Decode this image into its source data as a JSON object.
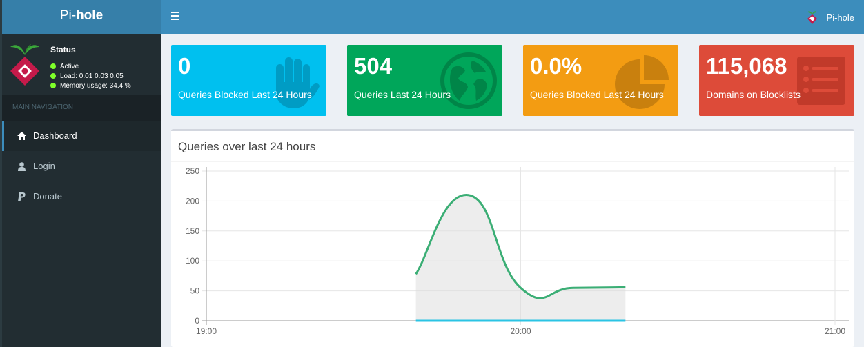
{
  "brand": {
    "prefix": "Pi-",
    "suffix": "hole"
  },
  "topbar": {
    "user_label": "Pi-hole"
  },
  "status": {
    "title": "Status",
    "active": "Active",
    "load": "Load:  0.01  0.03  0.05",
    "memory": "Memory usage:  34.4 %"
  },
  "nav": {
    "header": "MAIN NAVIGATION",
    "items": [
      {
        "label": "Dashboard",
        "icon": "home-icon"
      },
      {
        "label": "Login",
        "icon": "user-icon"
      },
      {
        "label": "Donate",
        "icon": "paypal-icon"
      }
    ]
  },
  "stats": [
    {
      "value": "0",
      "label": "Queries Blocked Last 24 Hours",
      "color": "#00c0ef",
      "icon": "hand-icon"
    },
    {
      "value": "504",
      "label": "Queries Last 24 Hours",
      "color": "#00a65a",
      "icon": "globe-icon"
    },
    {
      "value": "0.0%",
      "label": "Queries Blocked Last 24 Hours",
      "color": "#f39c12",
      "icon": "pie-chart-icon"
    },
    {
      "value": "115,068",
      "label": "Domains on Blocklists",
      "color": "#dd4b39",
      "icon": "list-icon"
    }
  ],
  "chart": {
    "title": "Queries over last 24 hours"
  },
  "chart_data": {
    "type": "area",
    "title": "Queries over last 24 hours",
    "x": [
      "19:40",
      "19:50",
      "20:00",
      "20:10",
      "20:20"
    ],
    "x_ticks": [
      "19:00",
      "20:00",
      "21:00"
    ],
    "xlim": [
      "19:00",
      "21:00"
    ],
    "ylim": [
      0,
      250
    ],
    "y_ticks": [
      0,
      50,
      100,
      150,
      200,
      250
    ],
    "grid": true,
    "series": [
      {
        "values": [
          78,
          210,
          55,
          55,
          56
        ],
        "color": "#3bae75"
      },
      {
        "values": [
          0,
          0,
          0,
          0,
          0
        ],
        "color": "#2bc4e4"
      }
    ]
  }
}
